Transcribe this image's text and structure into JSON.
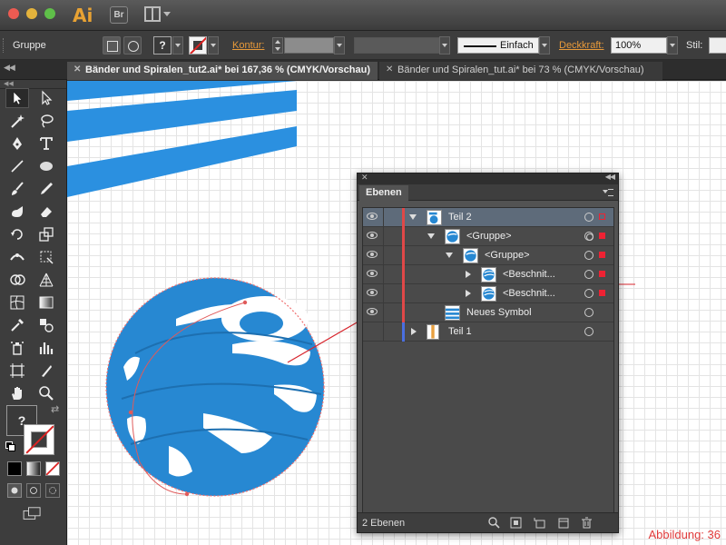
{
  "app": {
    "logo": "Ai",
    "bridge": "Br"
  },
  "control": {
    "selection": "Gruppe",
    "fill_value": "?",
    "stroke_label": "Kontur:",
    "brush": "Einfach",
    "opacity_label": "Deckkraft:",
    "opacity_value": "100%",
    "style_label": "Stil:"
  },
  "tabs": [
    {
      "title": "Bänder und Spiralen_tut2.ai* bei 167,36 % (CMYK/Vorschau)",
      "active": true
    },
    {
      "title": "Bänder und Spiralen_tut.ai* bei 73 % (CMYK/Vorschau)",
      "active": false
    }
  ],
  "toolbox": {
    "fill_value": "?"
  },
  "layers": {
    "tab": "Ebenen",
    "rows": [
      {
        "name": "Teil 2"
      },
      {
        "name": "<Gruppe>"
      },
      {
        "name": "<Gruppe>"
      },
      {
        "name": "<Beschnit..."
      },
      {
        "name": "<Beschnit..."
      },
      {
        "name": "Neues Symbol"
      },
      {
        "name": "Teil 1"
      }
    ],
    "count": "2 Ebenen"
  },
  "figure_label": "Abbildung: 36",
  "colors": {
    "accent_orange": "#e89a3a",
    "layer_red": "#e04848",
    "layer_blue": "#4a6fe0",
    "ribbon_blue": "#2a8fd8"
  }
}
